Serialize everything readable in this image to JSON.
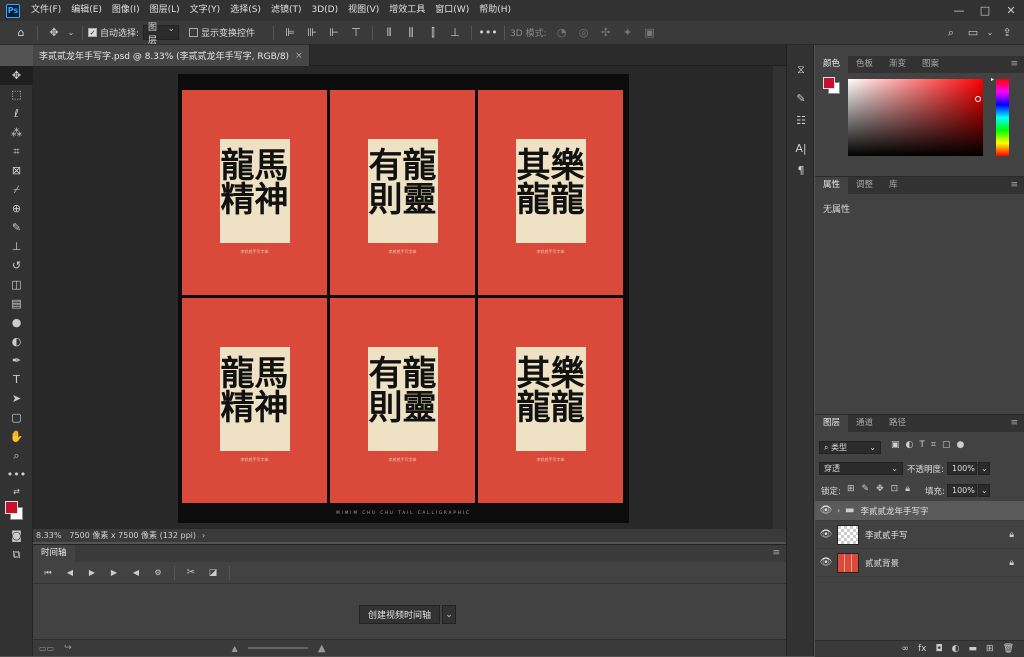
{
  "app": {
    "logo": "Ps"
  },
  "menu": [
    "文件(F)",
    "编辑(E)",
    "图像(I)",
    "图层(L)",
    "文字(Y)",
    "选择(S)",
    "滤镜(T)",
    "3D(D)",
    "视图(V)",
    "增效工具",
    "窗口(W)",
    "帮助(H)"
  ],
  "window_controls": {
    "minimize": "—",
    "maximize": "□",
    "close": "✕"
  },
  "options": {
    "auto_select_label": "自动选择:",
    "auto_select_value": "图层",
    "show_transform_label": "显示变换控件",
    "mode_3d_label": "3D 模式:",
    "more_label": "•••"
  },
  "document": {
    "tab_title": "李贰贰龙年手写字.psd @ 8.33% (李贰贰龙年手写字, RGB/8)",
    "tab_close": "×",
    "bottom_caption": "MIMIM CHU CHU TAIL CALLIGRAPHIC",
    "card_caption": "李贰贰手写字体",
    "posters": [
      {
        "text": "龍馬精神"
      },
      {
        "text": "有龍則靈"
      },
      {
        "text": "其樂龍龍"
      },
      {
        "text": "龍馬精神"
      },
      {
        "text": "有龍則靈"
      },
      {
        "text": "其樂龍龍"
      }
    ]
  },
  "status": {
    "zoom": "8.33%",
    "info": "7500 像素 x 7500 像素 (132 ppi)",
    "arrow": "›"
  },
  "timeline": {
    "tab_label": "时间轴",
    "create_button": "创建视频时间轴",
    "dropdown_arrow": "⌄"
  },
  "color_panel": {
    "tabs": [
      "颜色",
      "色板",
      "渐变",
      "图案"
    ],
    "fg_color": "#c8102e",
    "bg_color": "#ffffff"
  },
  "properties_panel": {
    "tabs": [
      "属性",
      "调整",
      "库"
    ],
    "content": "无属性"
  },
  "layers_panel": {
    "tabs": [
      "图层",
      "通道",
      "路径"
    ],
    "filter_label": "类型",
    "blend_mode": "穿透",
    "opacity_label": "不透明度:",
    "opacity_value": "100%",
    "lock_label": "锁定:",
    "fill_label": "填充:",
    "fill_value": "100%",
    "layers": [
      {
        "name": "李贰贰龙年手写字",
        "type": "group"
      },
      {
        "name": "李贰贰手写",
        "type": "transparent"
      },
      {
        "name": "贰贰背景",
        "type": "image"
      }
    ]
  },
  "colors": {
    "accent": "#31a8ff",
    "poster_red": "#d94a3a",
    "card_cream": "#efe2c4"
  }
}
